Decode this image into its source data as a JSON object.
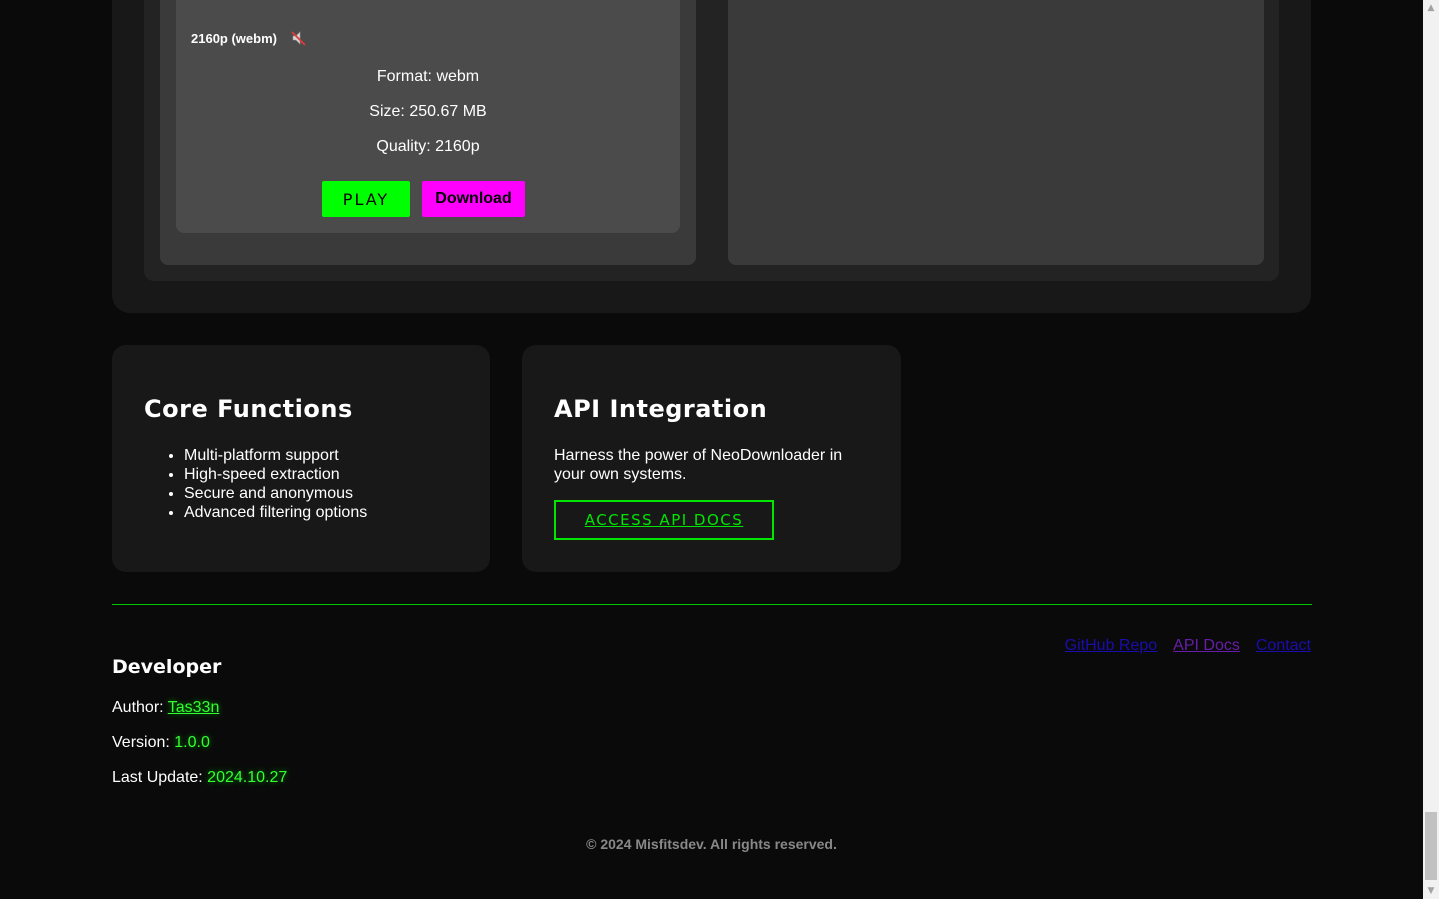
{
  "format_card": {
    "title": "2160p (webm)",
    "muted_icon": "speaker-muted-icon",
    "format_line": "Format: webm",
    "size_line": "Size: 250.67 MB",
    "quality_line": "Quality: 2160p",
    "play_label": "PLAY",
    "download_label": "Download"
  },
  "core": {
    "title": "Core Functions",
    "items": [
      "Multi-platform support",
      "High-speed extraction",
      "Secure and anonymous",
      "Advanced filtering options"
    ]
  },
  "api": {
    "title": "API Integration",
    "description": "Harness the power of NeoDownloader in your own systems.",
    "button_label": "ACCESS API DOCS"
  },
  "developer": {
    "title": "Developer",
    "author_label": "Author: ",
    "author_value": "Tas33n",
    "version_label": "Version: ",
    "version_value": "1.0.0",
    "update_label": "Last Update: ",
    "update_value": "2024.10.27"
  },
  "footer": {
    "links": [
      "GitHub Repo",
      "API Docs",
      "Contact"
    ],
    "copyright": "© 2024 Misfitsdev. All rights reserved."
  },
  "colors": {
    "accent_green": "#00ff00",
    "accent_magenta": "#ff00ff",
    "background": "#0a0a0a"
  }
}
